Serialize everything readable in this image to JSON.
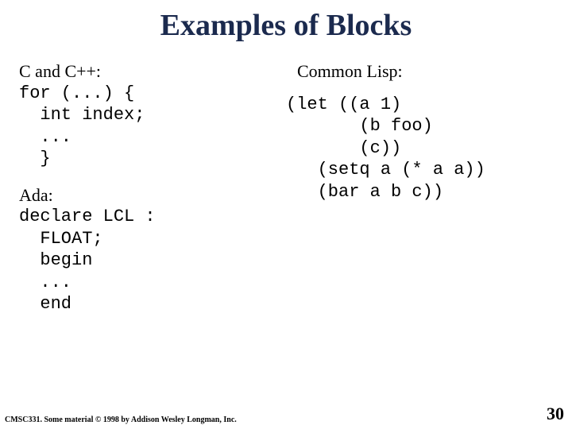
{
  "title": "Examples of Blocks",
  "left": {
    "c_label": "C and C++:",
    "c_code": "for (...) {\n  int index;\n  ...\n  }",
    "ada_label": "Ada:",
    "ada_code": "declare LCL :\n  FLOAT;\n  begin\n  ...\n  end"
  },
  "right": {
    "lisp_label": "Common Lisp:",
    "lisp_code": "(let ((a 1)\n       (b foo)\n       (c))\n   (setq a (* a a))\n   (bar a b c))"
  },
  "footer": "CMSC331. Some material © 1998 by Addison Wesley Longman, Inc.",
  "page_number": "30"
}
